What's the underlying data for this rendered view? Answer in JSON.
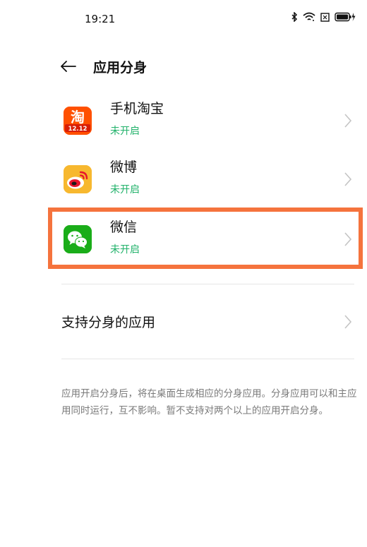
{
  "status_bar": {
    "time": "19:21",
    "icons": [
      "bluetooth-icon",
      "wifi-icon",
      "sim-icon",
      "battery-charging-icon"
    ]
  },
  "header": {
    "back_icon": "arrow-left-icon",
    "title": "应用分身"
  },
  "apps": [
    {
      "name": "手机淘宝",
      "status": "未开启",
      "icon": "taobao-icon",
      "icon_text": "淘",
      "icon_badge": "12.12"
    },
    {
      "name": "微博",
      "status": "未开启",
      "icon": "weibo-icon"
    },
    {
      "name": "微信",
      "status": "未开启",
      "icon": "wechat-icon",
      "highlighted": true
    }
  ],
  "support": {
    "label": "支持分身的应用"
  },
  "note": "应用开启分身后，将在桌面生成相应的分身应用。分身应用可以和主应用同时运行，互不影响。暂不支持对两个以上的应用开启分身。",
  "colors": {
    "status_green": "#22b26b",
    "highlight_orange": "#f5733d",
    "taobao_orange": "#ff5000",
    "weibo_yellow": "#f7b82f",
    "wechat_green": "#1aad19"
  }
}
